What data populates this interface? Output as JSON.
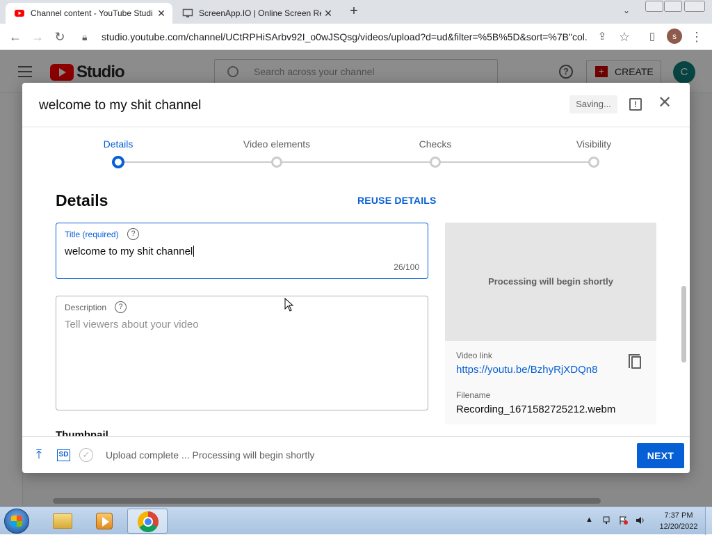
{
  "browser": {
    "tabs": [
      {
        "title": "Channel content - YouTube Studi",
        "active": true
      },
      {
        "title": "ScreenApp.IO | Online Screen Re",
        "active": false
      }
    ],
    "url": "studio.youtube.com/channel/UCtRPHiSArbv92I_o0wJSQsg/videos/upload?d=ud&filter=%5B%5D&sort=%7B\"col...",
    "profile_initial": "s"
  },
  "studio": {
    "logo_text": "Studio",
    "search_placeholder": "Search across your channel",
    "create_label": "CREATE",
    "avatar_initial": "C"
  },
  "dialog": {
    "title": "welcome to my shit channel",
    "saving_label": "Saving...",
    "steps": [
      {
        "label": "Details",
        "active": true
      },
      {
        "label": "Video elements",
        "active": false
      },
      {
        "label": "Checks",
        "active": false
      },
      {
        "label": "Visibility",
        "active": false
      }
    ],
    "heading": "Details",
    "reuse_label": "REUSE DETAILS",
    "title_field": {
      "label": "Title (required)",
      "value": "welcome to my shit channel",
      "count": "26/100"
    },
    "description_field": {
      "label": "Description",
      "placeholder": "Tell viewers about your video"
    },
    "thumbnail_heading": "Thumbnail",
    "preview_text": "Processing will begin shortly",
    "video_link_label": "Video link",
    "video_link": "https://youtu.be/BzhyRjXDQn8",
    "filename_label": "Filename",
    "filename": "Recording_1671582725212.webm",
    "footer": {
      "sd_badge": "SD",
      "status": "Upload complete ... Processing will begin shortly",
      "next_label": "NEXT"
    }
  },
  "taskbar": {
    "time": "7:37 PM",
    "date": "12/20/2022"
  },
  "colors": {
    "accent": "#065fd4",
    "youtube_red": "#ff0000"
  },
  "icons": [
    "youtube-icon",
    "monitor-icon",
    "close-icon",
    "plus-icon",
    "chevron-down-icon",
    "back-icon",
    "forward-icon",
    "reload-icon",
    "lock-icon",
    "share-icon",
    "star-icon",
    "sidebar-icon",
    "more-icon",
    "menu-icon",
    "search-icon",
    "help-icon",
    "feedback-icon",
    "copy-icon",
    "upload-icon",
    "check-circle-icon"
  ]
}
